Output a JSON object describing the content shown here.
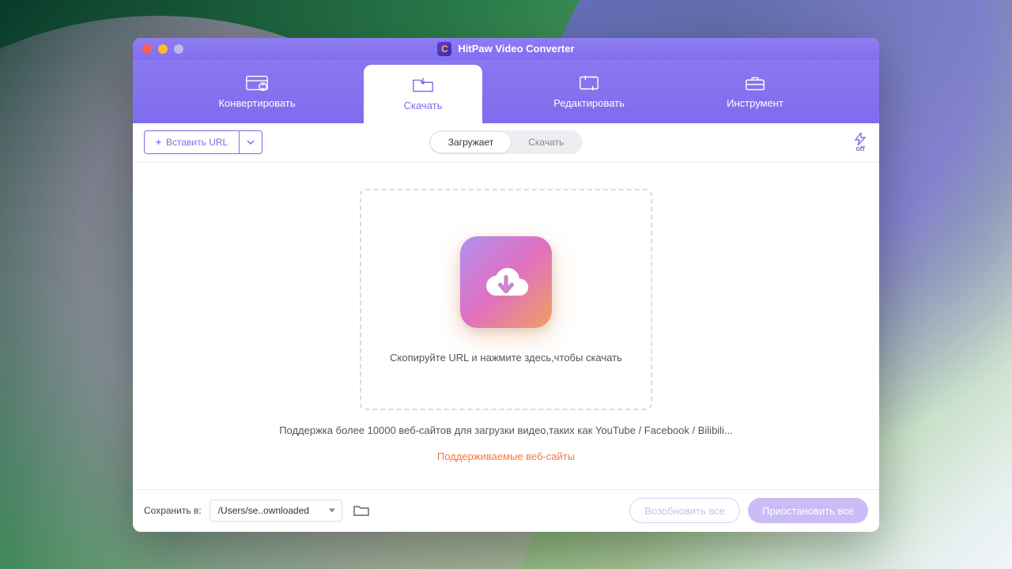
{
  "app": {
    "title": "HitPaw Video Converter",
    "iconLetter": "C"
  },
  "tabs": {
    "convert": "Конвертировать",
    "download": "Скачать",
    "edit": "Редактировать",
    "tool": "Инструмент",
    "active": "download"
  },
  "toolbar": {
    "paste_label": "Вставить URL",
    "seg_loading": "Загружает",
    "seg_download": "Скачать",
    "speed_state": "off"
  },
  "dropzone": {
    "text": "Скопируйте URL и нажмите здесь,чтобы скачать"
  },
  "support": {
    "text": "Поддержка более 10000 веб-сайтов для загрузки видео,таких как YouTube / Facebook / Bilibili...",
    "link": "Поддерживаемые веб-сайты"
  },
  "footer": {
    "save_label": "Сохранить в:",
    "save_path": "/Users/se..ownloaded",
    "resume_all": "Возобновить все",
    "pause_all": "Приостановить все"
  }
}
